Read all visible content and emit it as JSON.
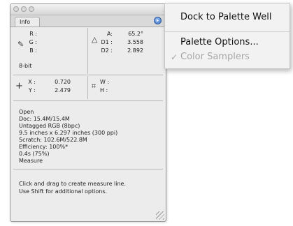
{
  "panel": {
    "tab_label": "Info",
    "menu_button_glyph": "▸",
    "colors": {
      "panel_bg": "#ececec",
      "menu_button": "#3d73c6"
    },
    "rgb": {
      "r_label": "R :",
      "g_label": "G :",
      "b_label": "B :",
      "icon": "eyedropper-icon"
    },
    "measure": {
      "icon": "angle-measure-icon",
      "a_label": "A:",
      "a_value": "65.2°",
      "d1_label": "D1 :",
      "d1_value": "3.558",
      "d2_label": "D2 :",
      "d2_value": "2.892"
    },
    "bit_depth": "8-bit",
    "position": {
      "icon": "crosshair-icon",
      "x_label": "X :",
      "x_value": "0.720",
      "y_label": "Y :",
      "y_value": "2.479"
    },
    "size": {
      "icon": "selection-size-icon",
      "w_label": "W :",
      "h_label": "H :"
    },
    "status": [
      "Open",
      "Doc: 15.4M/15.4M",
      "Untagged RGB (8bpc)",
      "9.5 inches x 6.297 inches (300 ppi)",
      "Scratch: 102.6M/522.8M",
      "Efficiency: 100%*",
      "0.4s (75%)",
      "Measure"
    ],
    "hint_lines": [
      "Click and drag to create measure line.",
      "Use Shift for additional options."
    ]
  },
  "flyout_menu": {
    "items": [
      {
        "label": "Dock to Palette Well",
        "enabled": true
      },
      {
        "label": "Palette Options...",
        "enabled": true
      },
      {
        "label": "Color Samplers",
        "enabled": false,
        "checked": true
      }
    ],
    "check_glyph": "✓"
  }
}
